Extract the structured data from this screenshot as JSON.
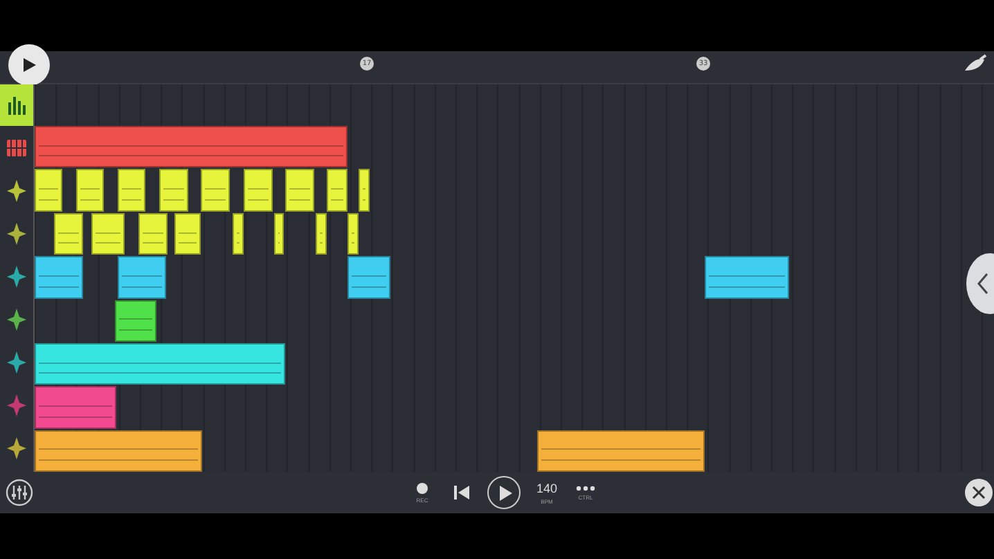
{
  "ruler": {
    "markers": [
      "17",
      "33"
    ]
  },
  "sidebar": [
    {
      "kind": "tool",
      "selected": true
    },
    {
      "kind": "pattern",
      "color": "#e84a48"
    },
    {
      "kind": "audio",
      "color": "#b7c23a"
    },
    {
      "kind": "audio",
      "color": "#a9b23a"
    },
    {
      "kind": "audio",
      "color": "#2aa9a8"
    },
    {
      "kind": "audio",
      "color": "#5ab24a"
    },
    {
      "kind": "audio",
      "color": "#2aa9a8"
    },
    {
      "kind": "audio",
      "color": "#c23a72"
    },
    {
      "kind": "audio",
      "color": "#b7a83a"
    }
  ],
  "tracks": [
    {
      "color": "#f0504c"
    },
    {
      "color": "#e6f53c"
    },
    {
      "color": "#e6f53c"
    },
    {
      "color": "#3fcdf0"
    },
    {
      "color": "#4fe04a"
    },
    {
      "color": "#36e4e0"
    },
    {
      "color": "#f24a8e"
    },
    {
      "color": "#f5b03c"
    }
  ],
  "transport": [
    {
      "kind": "record",
      "label": "REC"
    },
    {
      "kind": "rewind"
    },
    {
      "kind": "play"
    },
    {
      "kind": "tempo",
      "value": "140",
      "label": "BPM"
    },
    {
      "kind": "more",
      "label": "CTRL"
    }
  ]
}
